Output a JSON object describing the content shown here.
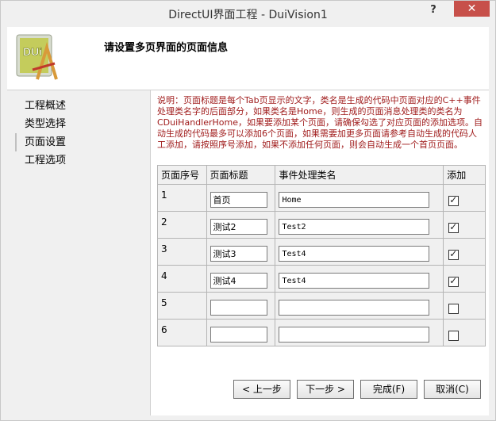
{
  "window": {
    "title": "DirectUI界面工程 - DuiVision1",
    "help": "?",
    "close": "✕"
  },
  "header": {
    "logo_text": "DUi",
    "title": "请设置多页界面的页面信息"
  },
  "nav": {
    "items": [
      {
        "label": "工程概述"
      },
      {
        "label": "类型选择"
      },
      {
        "label": "页面设置"
      },
      {
        "label": "工程选项"
      }
    ],
    "active_index": 2
  },
  "description": "说明：页面标题是每个Tab页显示的文字，类名是生成的代码中页面对应的C++事件处理类名字的后面部分，如果类名是Home，则生成的页面消息处理类的类名为CDuiHandlerHome，如果要添加某个页面，请确保勾选了对应页面的添加选项。自动生成的代码最多可以添加6个页面，如果需要加更多页面请参考自动生成的代码人工添加，请按照序号添加，如果不添加任何页面，则会自动生成一个首页页面。",
  "table": {
    "headers": [
      "页面序号",
      "页面标题",
      "事件处理类名",
      "添加"
    ],
    "rows": [
      {
        "index": "1",
        "title": "首页",
        "class": "Home",
        "add": true
      },
      {
        "index": "2",
        "title": "测试2",
        "class": "Test2",
        "add": true
      },
      {
        "index": "3",
        "title": "测试3",
        "class": "Test4",
        "add": true
      },
      {
        "index": "4",
        "title": "测试4",
        "class": "Test4",
        "add": true
      },
      {
        "index": "5",
        "title": "",
        "class": "",
        "add": false
      },
      {
        "index": "6",
        "title": "",
        "class": "",
        "add": false
      }
    ]
  },
  "buttons": {
    "prev": "< 上一步",
    "next": "下一步 >",
    "finish": "完成(F)",
    "cancel": "取消(C)"
  },
  "colors": {
    "close_button": "#c7504a",
    "description_text": "#a01c1c"
  }
}
